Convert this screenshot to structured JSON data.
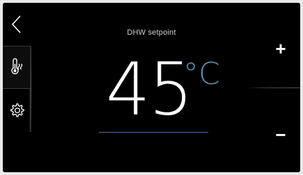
{
  "nav": {
    "back_icon": "chevron-left-icon",
    "tabs": [
      {
        "icon": "thermometer-icon",
        "selected": true
      },
      {
        "icon": "gear-icon",
        "selected": false
      }
    ]
  },
  "setpoint": {
    "title": "DHW setpoint",
    "value": "45",
    "unit": "°C",
    "unit_color": "#5a8cae"
  },
  "controls": {
    "increase_label": "+",
    "decrease_label": "−"
  },
  "colors": {
    "background": "#000000",
    "accent": "#4f6fa8",
    "text": "#ffffff"
  }
}
